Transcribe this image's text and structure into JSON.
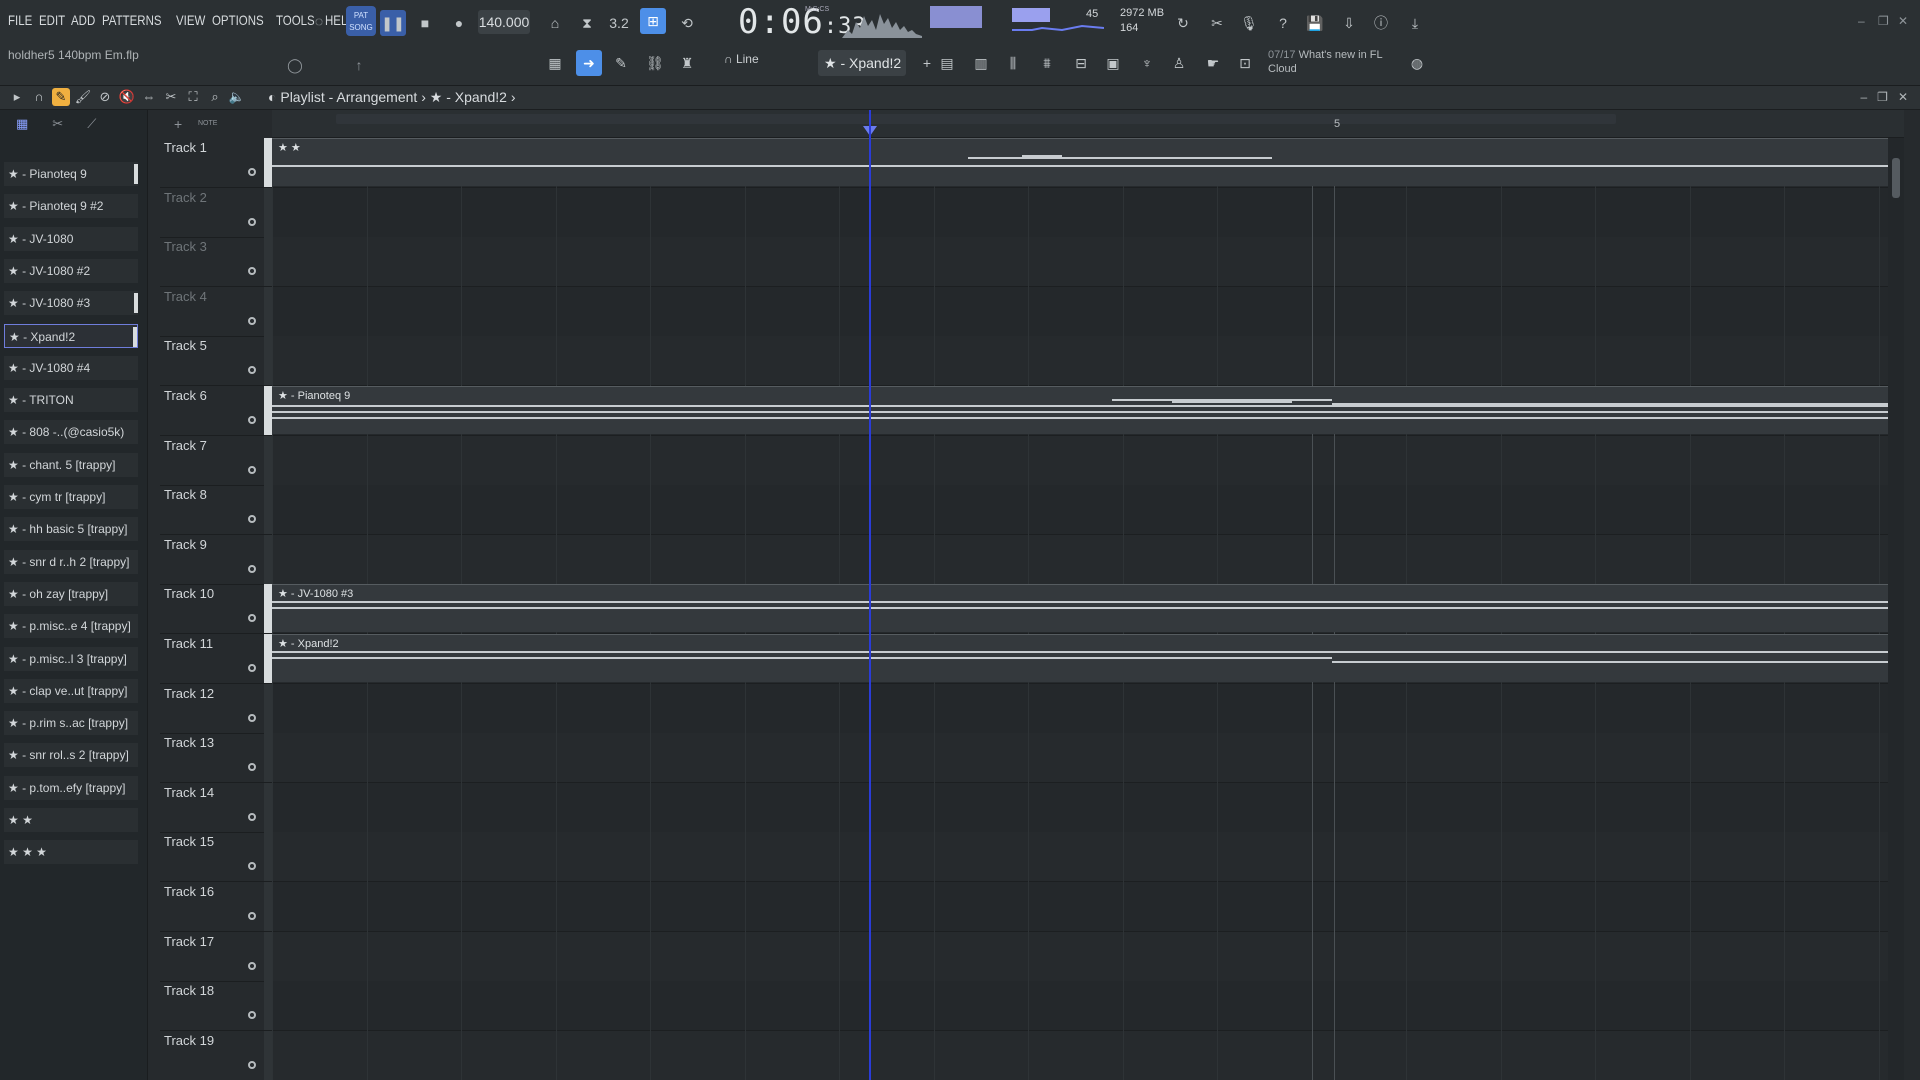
{
  "menu": [
    "FILE",
    "EDIT",
    "ADD",
    "PATTERNS",
    "VIEW",
    "OPTIONS",
    "TOOLS",
    "HELP"
  ],
  "project": {
    "filename": "holdher5 140bpm Em.flp"
  },
  "transport": {
    "mode_top": "PAT",
    "mode_bottom": "SONG",
    "bpm": "140.000",
    "time_main": "0:06",
    "time_sub": ":33",
    "time_format": "M:S:CS"
  },
  "meters": {
    "cpu": "45",
    "memory": "2972 MB",
    "polyphony": "164"
  },
  "toolbar": {
    "snap": "Line",
    "pattern": "★ - Xpand!2"
  },
  "news": {
    "count": "07/17",
    "text": "What's new in FL",
    "subtext": "Cloud"
  },
  "playlist": {
    "title": "Playlist - Arrangement",
    "crumb": "★ - Xpand!2",
    "ruler_bar_label": "5",
    "picker_tabs": [
      "notes",
      "cut",
      "draw"
    ],
    "picker_items": [
      "★ - Pianoteq 9",
      "★ - Pianoteq 9 #2",
      "★ - JV-1080",
      "★ - JV-1080 #2",
      "★ - JV-1080 #3",
      "★ - Xpand!2",
      "★ - JV-1080 #4",
      "★ - TRITON",
      "★ - 808 -..(@casio5k)",
      "★ - chant. 5 [trappy]",
      "★ - cym tr [trappy]",
      "★ - hh basic 5 [trappy]",
      "★ - snr d r..h 2 [trappy]",
      "★ - oh zay [trappy]",
      "★ - p.misc..e 4 [trappy]",
      "★ - p.misc..l 3 [trappy]",
      "★ - clap ve..ut [trappy]",
      "★ - p.rim s..ac [trappy]",
      "★ - snr rol..s 2 [trappy]",
      "★ - p.tom..efy [trappy]",
      "★ ★",
      "★ ★ ★"
    ],
    "selected_picker": "★ - Xpand!2",
    "tracks": [
      "Track 1",
      "Track 2",
      "Track 3",
      "Track 4",
      "Track 5",
      "Track 6",
      "Track 7",
      "Track 8",
      "Track 9",
      "Track 10",
      "Track 11",
      "Track 12",
      "Track 13",
      "Track 14",
      "Track 15",
      "Track 16",
      "Track 17",
      "Track 18",
      "Track 19"
    ],
    "clips": [
      {
        "track": 1,
        "name": "★ ★"
      },
      {
        "track": 6,
        "name": "★ - Pianoteq 9"
      },
      {
        "track": 10,
        "name": "★ - JV-1080 #3"
      },
      {
        "track": 11,
        "name": "★ - Xpand!2"
      }
    ]
  },
  "colors": {
    "accent": "#4d8fe8",
    "playhead": "#2a3cd8",
    "selection": "#6f7ddc"
  }
}
